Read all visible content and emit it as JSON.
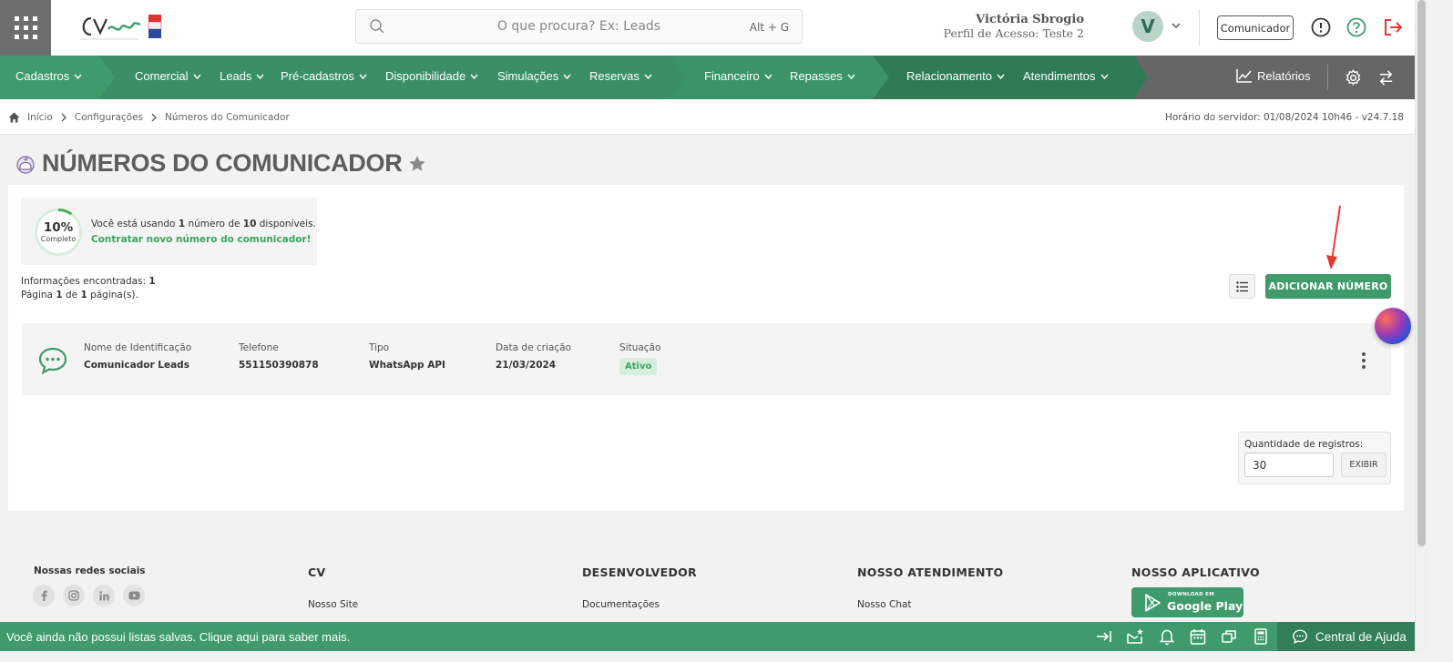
{
  "header": {
    "search_placeholder": "O que procura? Ex: Leads",
    "search_shortcut": "Alt + G",
    "user_name": "Victória Sbrogio",
    "user_profile": "Perfil de Acesso: Teste 2",
    "avatar_initial": "V",
    "communicator_label": "Comunicador"
  },
  "nav": {
    "items": [
      {
        "label": "Cadastros"
      },
      {
        "label": "Comercial"
      },
      {
        "label": "Leads"
      },
      {
        "label": "Pré-cadastros"
      },
      {
        "label": "Disponibilidade"
      },
      {
        "label": "Simulações"
      },
      {
        "label": "Reservas"
      },
      {
        "label": "Financeiro"
      },
      {
        "label": "Repasses"
      },
      {
        "label": "Relacionamento"
      },
      {
        "label": "Atendimentos"
      }
    ],
    "reports_label": "Relatórios",
    "colors": {
      "seg1": "#3f9b6c",
      "seg2": "#3a8f67",
      "seg3": "#3b9468",
      "seg4": "#2f7b56",
      "rest": "#666666"
    }
  },
  "breadcrumb": {
    "items": [
      "Início",
      "Configurações",
      "Números do Comunicador"
    ],
    "server_time": "Horário do servidor: 01/08/2024 10h46 - v24.7.18"
  },
  "page": {
    "title": "NÚMEROS DO COMUNICADOR"
  },
  "usage": {
    "percent": "10%",
    "percent_value": 10,
    "percent_label": "Completo",
    "msg_prefix": "Você está usando ",
    "msg_used": "1",
    "msg_middle": " número de ",
    "msg_total": "10",
    "msg_suffix": " disponíveis.",
    "link": "Contratar novo número do comunicador!"
  },
  "results": {
    "found_label": "Informações encontradas: ",
    "found_count": "1",
    "page_label": "Página ",
    "page_current": "1",
    "page_of": " de ",
    "page_total": "1",
    "page_suffix": " página(s)."
  },
  "add_button": "ADICIONAR NÚMERO",
  "table": {
    "headers": {
      "name": "Nome de Identificação",
      "phone": "Telefone",
      "type": "Tipo",
      "created": "Data de criação",
      "status": "Situação"
    },
    "rows": [
      {
        "name": "Comunicador Leads",
        "phone": "551150390878",
        "type": "WhatsApp API",
        "created": "21/03/2024",
        "status": "Ativo"
      }
    ]
  },
  "records": {
    "label": "Quantidade de registros:",
    "value": "30",
    "button": "EXIBIR"
  },
  "footer": {
    "social_title": "Nossas redes sociais",
    "cols": [
      {
        "title": "CV",
        "link": "Nosso Site"
      },
      {
        "title": "DESENVOLVEDOR",
        "link": "Documentações"
      },
      {
        "title": "NOSSO ATENDIMENTO",
        "link": "Nosso Chat"
      },
      {
        "title": "NOSSO APLICATIVO"
      }
    ],
    "gplay_small": "DOWNLOAD EM",
    "gplay_big": "Google Play"
  },
  "bottombar": {
    "message": "Você ainda não possui listas salvas. Clique aqui para saber mais.",
    "help_label": "Central de Ajuda"
  }
}
